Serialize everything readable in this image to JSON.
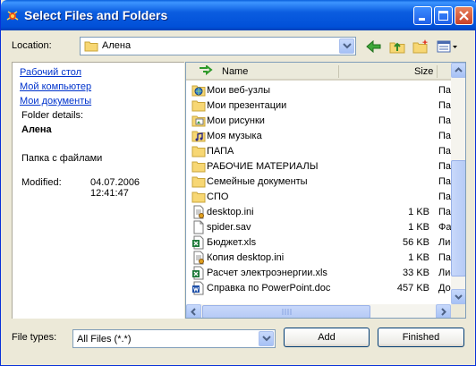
{
  "window": {
    "title": "Select Files and Folders"
  },
  "location": {
    "label": "Location:",
    "value": "Алена"
  },
  "left_pane": {
    "links": [
      "Рабочий стол",
      "Мой компьютер",
      "Мои документы"
    ],
    "details_label": "Folder details:",
    "folder_name": "Алена",
    "folder_type": "Папка с файлами",
    "modified_label": "Modified:",
    "modified_date": "04.07.2006",
    "modified_time": "12:41:47"
  },
  "list": {
    "columns": {
      "name": "Name",
      "size": "Size"
    },
    "rows": [
      {
        "icon": "web-folder-icon",
        "name": "Мои веб-узлы",
        "size": "",
        "type": "Папка"
      },
      {
        "icon": "folder-icon",
        "name": "Мои презентации",
        "size": "",
        "type": "Папка"
      },
      {
        "icon": "pictures-folder-icon",
        "name": "Мои рисунки",
        "size": "",
        "type": "Папка"
      },
      {
        "icon": "music-folder-icon",
        "name": "Моя музыка",
        "size": "",
        "type": "Папка"
      },
      {
        "icon": "folder-icon",
        "name": "ПАПА",
        "size": "",
        "type": "Папка"
      },
      {
        "icon": "folder-icon",
        "name": "РАБОЧИЕ МАТЕРИАЛЫ",
        "size": "",
        "type": "Папка"
      },
      {
        "icon": "folder-icon",
        "name": "Семейные документы",
        "size": "",
        "type": "Папка"
      },
      {
        "icon": "folder-icon",
        "name": "СПО",
        "size": "",
        "type": "Папка"
      },
      {
        "icon": "ini-file-icon",
        "name": "desktop.ini",
        "size": "1 KB",
        "type": "Параметры"
      },
      {
        "icon": "generic-file-icon",
        "name": "spider.sav",
        "size": "1 KB",
        "type": "Файл"
      },
      {
        "icon": "excel-file-icon",
        "name": "Бюджет.xls",
        "size": "56 KB",
        "type": "Лист"
      },
      {
        "icon": "ini-file-icon",
        "name": "Копия desktop.ini",
        "size": "1 KB",
        "type": "Параметры"
      },
      {
        "icon": "excel-file-icon",
        "name": "Расчет электроэнергии.xls",
        "size": "33 KB",
        "type": "Лист"
      },
      {
        "icon": "word-file-icon",
        "name": "Справка по PowerPoint.doc",
        "size": "457 KB",
        "type": "Документ"
      }
    ]
  },
  "file_types": {
    "label": "File types:",
    "value": "All Files (*.*)"
  },
  "buttons": {
    "add": "Add",
    "finished": "Finished"
  },
  "colors": {
    "title_bar": "#0150d8",
    "link": "#0033cc",
    "dialog_bg": "#ece9d8"
  }
}
